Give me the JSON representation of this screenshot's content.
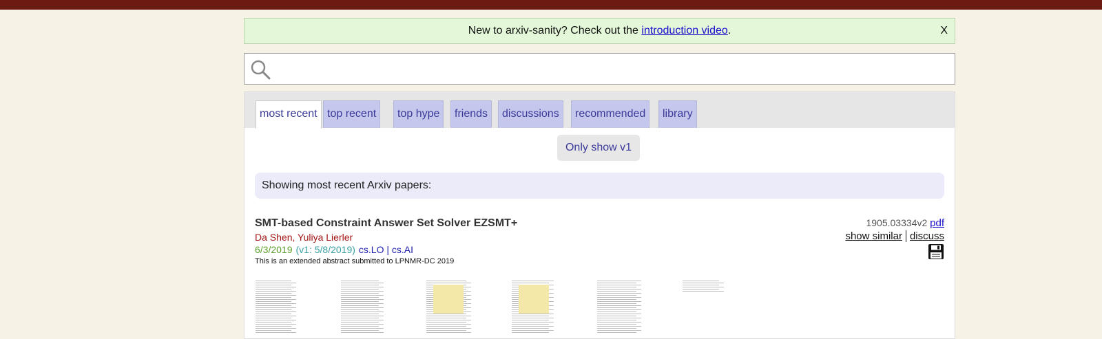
{
  "banner": {
    "text_before": "New to arxiv-sanity? Check out the ",
    "link_text": "introduction video",
    "text_after": ".",
    "close_label": "X"
  },
  "search": {
    "placeholder": "",
    "value": ""
  },
  "tabs": [
    {
      "label": "most recent",
      "active": true
    },
    {
      "label": "top recent",
      "active": false
    },
    {
      "label": "top hype",
      "active": false
    },
    {
      "label": "friends",
      "active": false
    },
    {
      "label": "discussions",
      "active": false
    },
    {
      "label": "recommended",
      "active": false
    },
    {
      "label": "library",
      "active": false
    }
  ],
  "v1_button": "Only show v1",
  "showing_text": "Showing most recent Arxiv papers:",
  "paper": {
    "title": "SMT-based Constraint Answer Set Solver EZSMT+",
    "authors": "Da Shen, Yuliya Lierler",
    "date": "6/3/2019",
    "v1_date": "(v1: 5/8/2019)",
    "categories": "cs.LO | cs.AI",
    "comment": "This is an extended abstract submitted to LPNMR-DC 2019",
    "arxiv_id": "1905.03334v2",
    "pdf_label": "pdf",
    "show_similar_label": "show similar",
    "discuss_label": "discuss"
  },
  "icons": {
    "search": "search-icon",
    "save": "floppy-disk-icon"
  },
  "colors": {
    "topbar": "#6d1a12",
    "banner_bg": "#e4f8d9",
    "tab_bg": "#c5c8ec",
    "authors": "#a31515",
    "date": "#5c9e2d",
    "v1_date": "#3aa0a0"
  }
}
